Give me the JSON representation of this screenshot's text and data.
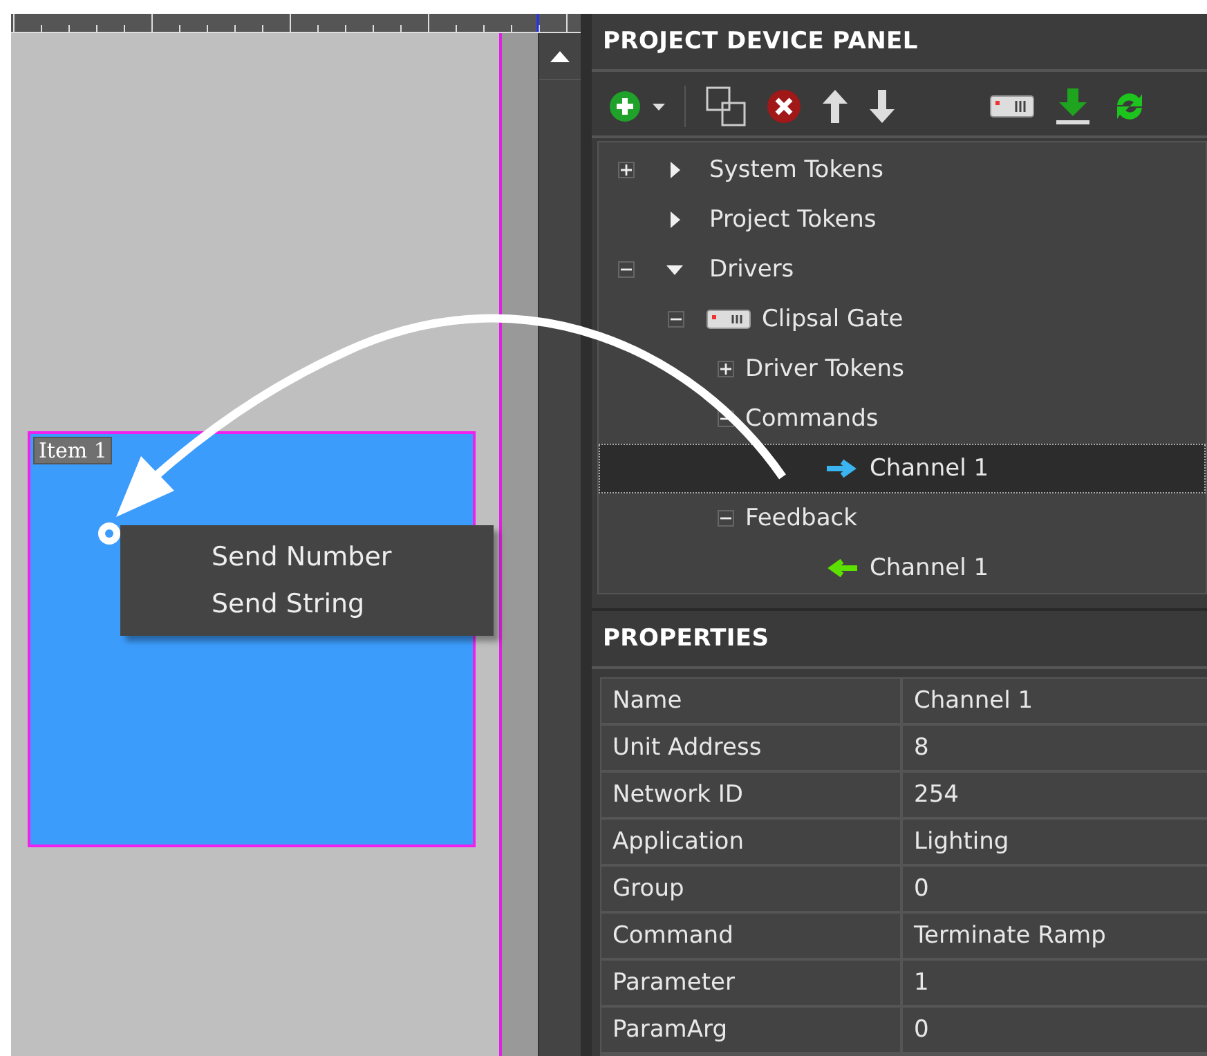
{
  "canvas": {
    "item": {
      "label": "Item 1"
    },
    "context_menu": {
      "items": [
        {
          "label": "Send Number"
        },
        {
          "label": "Send String"
        }
      ]
    }
  },
  "device_panel": {
    "title": "PROJECT DEVICE PANEL",
    "tree": [
      {
        "label": "System Tokens",
        "kind": "category",
        "expandable": true,
        "expanded": false,
        "selected": false
      },
      {
        "label": "Project Tokens",
        "kind": "category",
        "selected": false
      },
      {
        "label": "Drivers",
        "kind": "category",
        "expandable": true,
        "expanded": true,
        "selected": false,
        "children": [
          {
            "label": "Clipsal Gate",
            "kind": "device",
            "expandable": true,
            "expanded": true,
            "selected": false,
            "children": [
              {
                "label": "Driver Tokens",
                "kind": "group",
                "expandable": true,
                "expanded": false,
                "selected": false
              },
              {
                "label": "Commands",
                "kind": "group",
                "expandable": true,
                "expanded": true,
                "selected": false,
                "children": [
                  {
                    "label": "Channel 1",
                    "kind": "command",
                    "selected": true
                  }
                ]
              },
              {
                "label": "Feedback",
                "kind": "group",
                "expandable": true,
                "expanded": true,
                "selected": false,
                "children": [
                  {
                    "label": "Channel 1",
                    "kind": "feedback",
                    "selected": false
                  }
                ]
              }
            ]
          }
        ]
      }
    ]
  },
  "properties": {
    "title": "PROPERTIES",
    "rows": [
      {
        "name": "Name",
        "value": "Channel 1"
      },
      {
        "name": "Unit Address",
        "value": "8"
      },
      {
        "name": "Network ID",
        "value": "254"
      },
      {
        "name": "Application",
        "value": "Lighting"
      },
      {
        "name": "Group",
        "value": "0"
      },
      {
        "name": "Command",
        "value": "Terminate Ramp"
      },
      {
        "name": "Parameter",
        "value": "1"
      },
      {
        "name": "ParamArg",
        "value": "0"
      }
    ]
  }
}
